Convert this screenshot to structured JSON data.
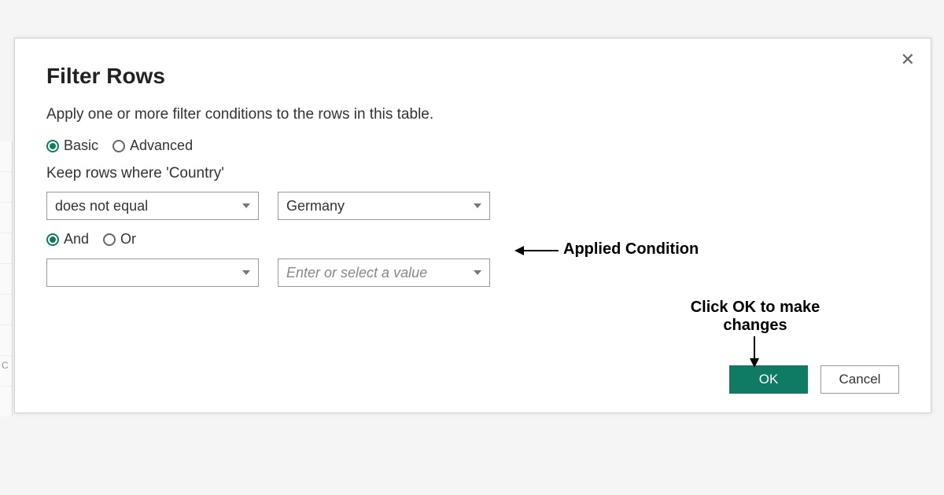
{
  "dialog": {
    "title": "Filter Rows",
    "description": "Apply one or more filter conditions to the rows in this table.",
    "close_glyph": "✕",
    "mode": {
      "basic": "Basic",
      "advanced": "Advanced",
      "selected": "basic"
    },
    "keep_rows_label": "Keep rows where 'Country'",
    "logic": {
      "and": "And",
      "or": "Or",
      "selected": "and"
    },
    "conditions": [
      {
        "operator": "does not equal",
        "value": "Germany",
        "value_placeholder": ""
      },
      {
        "operator": "",
        "value": "",
        "value_placeholder": "Enter or select a value"
      }
    ],
    "footer": {
      "ok": "OK",
      "cancel": "Cancel"
    }
  },
  "annotations": {
    "applied_condition": "Applied Condition",
    "click_ok_line1": "Click OK to make",
    "click_ok_line2": "changes"
  },
  "background": {
    "row_letter": "C"
  },
  "colors": {
    "accent": "#0f7b63"
  }
}
